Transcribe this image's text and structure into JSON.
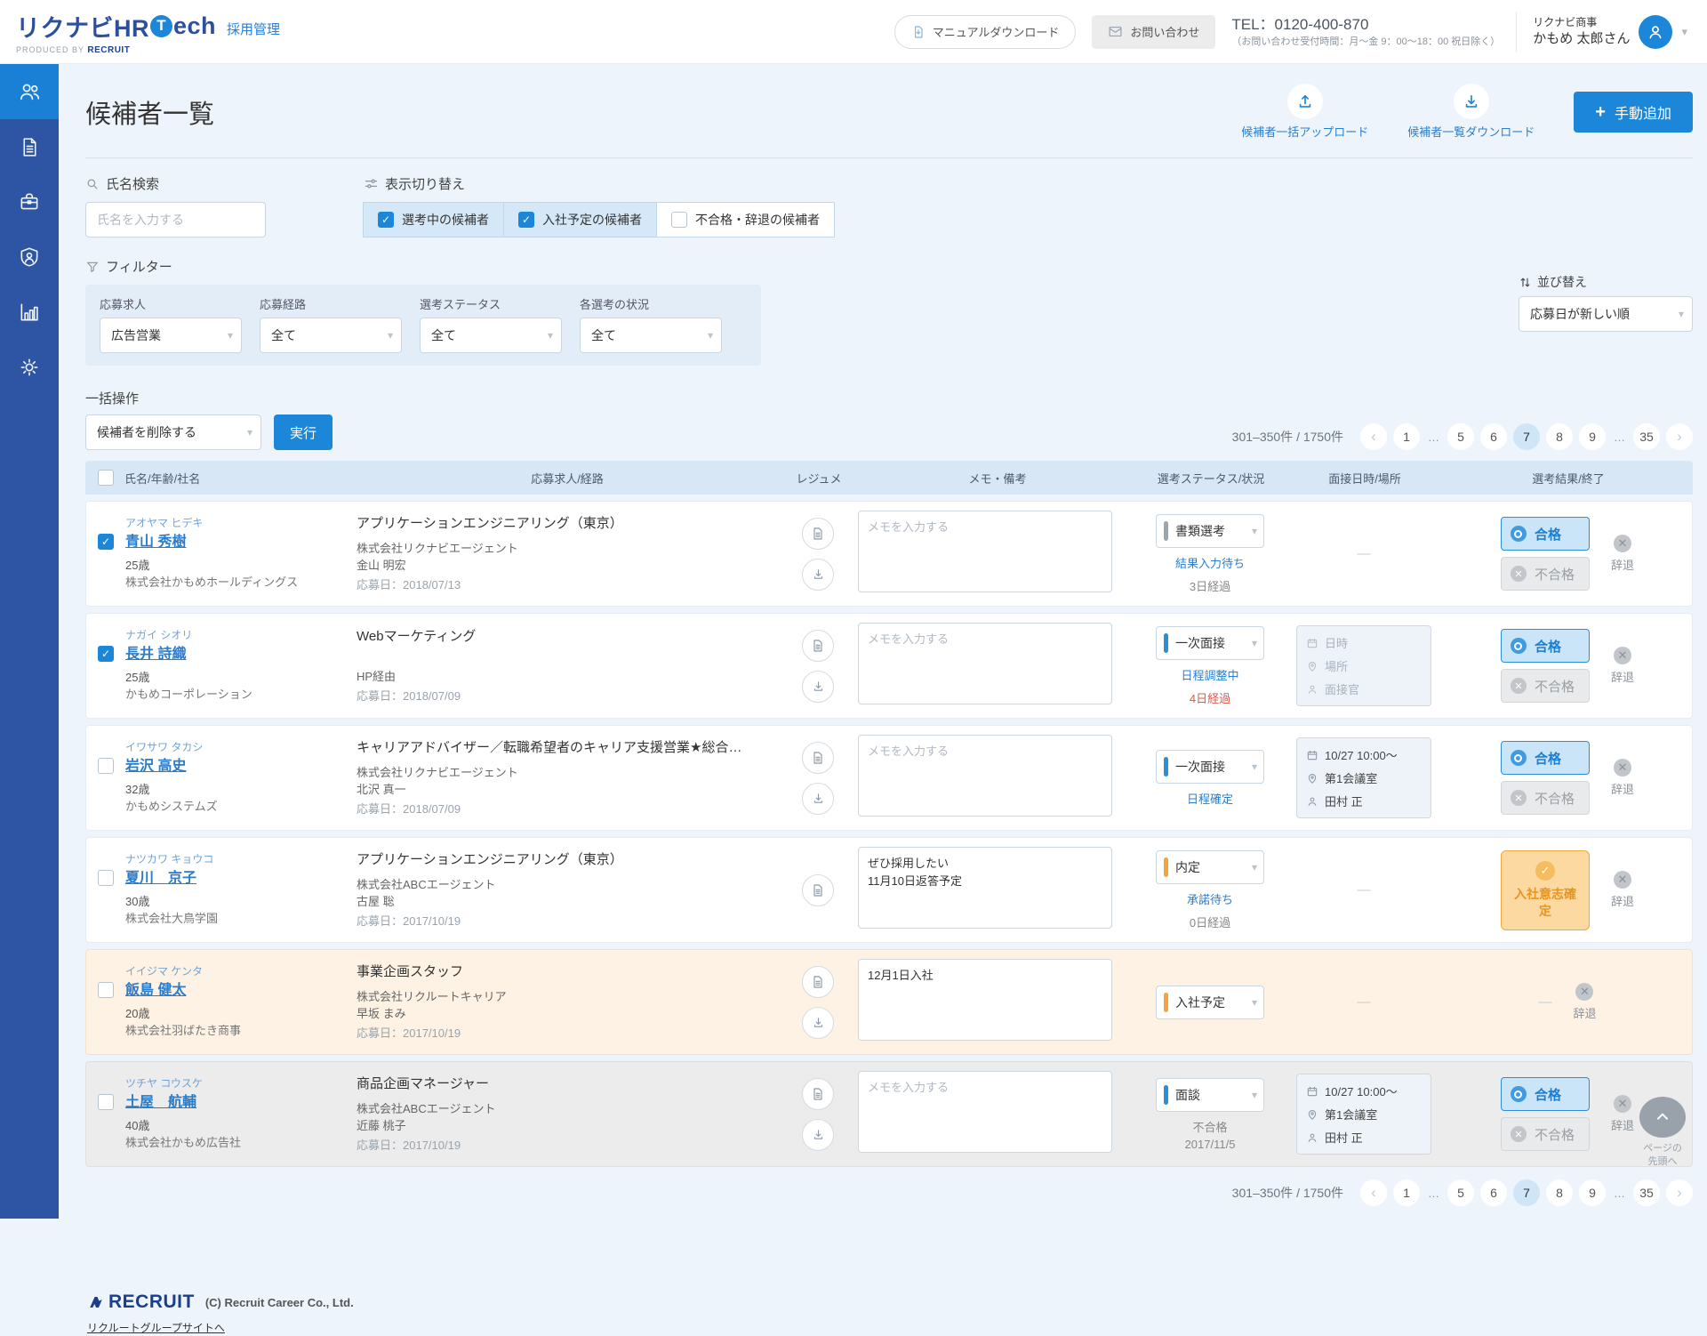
{
  "colors": {
    "accent_blue": "#1c87d8",
    "sidebar": "#2d55a3",
    "sidebar_active": "#1a80d6",
    "status_gray": "#9aa5b0",
    "status_blue": "#2a8fd8",
    "status_orange": "#f5a43c",
    "row_scheduled_bg": "#fdf2e3",
    "row_closed_bg": "#ececec",
    "alert_red": "#e05b4e"
  },
  "header": {
    "logo_main_left": "リクナビHR",
    "logo_t": "T",
    "logo_main_right": "ech",
    "logo_sub": "採用管理",
    "logo_produced": "PRODUCED BY ",
    "logo_recruit": "RECRUIT",
    "manual_download": "マニュアルダウンロード",
    "contact": "お問い合わせ",
    "tel": "TEL：0120-400-870",
    "tel_note": "（お問い合わせ受付時間：月〜金 9：00〜18：00 祝日除く）",
    "company": "リクナビ商事",
    "user": "かもめ 太郎さん"
  },
  "page": {
    "title": "候補者一覧",
    "upload_label": "候補者一括アップロード",
    "download_label": "候補者一覧ダウンロード",
    "add_label": "手動追加",
    "add_plus": "+"
  },
  "search": {
    "label": "氏名検索",
    "placeholder": "氏名を入力する"
  },
  "display_toggle": {
    "label": "表示切り替え",
    "options": [
      {
        "label": "選考中の候補者",
        "checked": true
      },
      {
        "label": "入社予定の候補者",
        "checked": true
      },
      {
        "label": "不合格・辞退の候補者",
        "checked": false
      }
    ]
  },
  "filters": {
    "label": "フィルター",
    "fields": [
      {
        "label": "応募求人",
        "value": "広告営業"
      },
      {
        "label": "応募経路",
        "value": "全て"
      },
      {
        "label": "選考ステータス",
        "value": "全て"
      },
      {
        "label": "各選考の状況",
        "value": "全て"
      }
    ],
    "sort": {
      "label": "並び替え",
      "value": "応募日が新しい順"
    }
  },
  "bulk": {
    "label": "一括操作",
    "action": "候補者を削除する",
    "execute": "実行"
  },
  "pagination": {
    "range": "301–350件 / 1750件",
    "prev": "‹",
    "next": "›",
    "pages": [
      "1",
      "…",
      "5",
      "6",
      "7",
      "8",
      "9",
      "…",
      "35"
    ],
    "active_page": "7"
  },
  "table": {
    "headers": [
      "氏名/年齢/社名",
      "応募求人/経路",
      "レジュメ",
      "メモ・備考",
      "選考ステータス/状況",
      "面接日時/場所",
      "選考結果/終了"
    ]
  },
  "rows": [
    {
      "checked": true,
      "kana": "アオヤマ ヒデキ",
      "name": "青山 秀樹",
      "age": "25歳",
      "company": "株式会社かもめホールディングス",
      "job_title": "アプリケーションエンジニアリング（東京）",
      "job_sub1": "株式会社リクナビエージェント",
      "job_sub2": "金山 明宏",
      "applied": "応募日：2018/07/13",
      "memo_placeholder": "メモを入力する",
      "status": "書類選考",
      "status_sub": "結果入力待ち",
      "status_note": "3日経過",
      "interview_dash": "—",
      "pass": "合格",
      "fail": "不合格",
      "decline": "辞退"
    },
    {
      "checked": true,
      "kana": "ナガイ シオリ",
      "name": "長井 詩織",
      "age": "25歳",
      "company": "かもめコーポレーション",
      "job_title": "Webマーケティング",
      "job_sub1": "HP経由",
      "applied": "応募日：2018/07/09",
      "memo_placeholder": "メモを入力する",
      "status": "一次面接",
      "status_sub": "日程調整中",
      "status_note": "4日経過",
      "interview_datetime": "日時",
      "interview_place": "場所",
      "interview_person": "面接官",
      "pass": "合格",
      "fail": "不合格",
      "decline": "辞退"
    },
    {
      "checked": false,
      "kana": "イワサワ タカシ",
      "name": "岩沢 高史",
      "age": "32歳",
      "company": "かもめシステムズ",
      "job_title": "キャリアアドバイザー／転職希望者のキャリア支援営業★総合…",
      "job_sub1": "株式会社リクナビエージェント",
      "job_sub2": "北沢 真一",
      "applied": "応募日：2018/07/09",
      "memo_placeholder": "メモを入力する",
      "status": "一次面接",
      "status_sub": "日程確定",
      "interview_datetime": "10/27  10:00〜",
      "interview_place": "第1会議室",
      "interview_person": "田村 正",
      "pass": "合格",
      "fail": "不合格",
      "decline": "辞退"
    },
    {
      "checked": false,
      "kana": "ナツカワ キョウコ",
      "name": "夏川　京子",
      "age": "30歳",
      "company": "株式会社大鳥学園",
      "job_title": "アプリケーションエンジニアリング（東京）",
      "job_sub1": "株式会社ABCエージェント",
      "job_sub2": "古屋 聡",
      "applied": "応募日：2017/10/19",
      "memo_value": "ぜひ採用したい\n11月10日返答予定",
      "status": "内定",
      "status_sub": "承諾待ち",
      "status_note": "0日経過",
      "interview_dash": "—",
      "confirm": "入社意志確定",
      "decline": "辞退"
    },
    {
      "checked": false,
      "kana": "イイジマ ケンタ",
      "name": "飯島 健太",
      "age": "20歳",
      "company": "株式会社羽ばたき商事",
      "job_title": "事業企画スタッフ",
      "job_sub1": "株式会社リクルートキャリア",
      "job_sub2": "早坂 まみ",
      "applied": "応募日：2017/10/19",
      "memo_value": "12月1日入社",
      "status": "入社予定",
      "interview_dash": "—",
      "result_dash": "—",
      "decline": "辞退"
    },
    {
      "checked": false,
      "kana": "ツチヤ コウスケ",
      "name": "土屋　航輔",
      "age": "40歳",
      "company": "株式会社かもめ広告社",
      "job_title": "商品企画マネージャー",
      "job_sub1": "株式会社ABCエージェント",
      "job_sub2": "近藤 桃子",
      "applied": "応募日：2017/10/19",
      "memo_placeholder": "メモを入力する",
      "status": "面談",
      "status_sub": "不合格",
      "status_note": "2017/11/5",
      "interview_datetime": "10/27  10:00〜",
      "interview_place": "第1会議室",
      "interview_person": "田村 正",
      "pass": "合格",
      "fail": "不合格",
      "decline": "辞退"
    }
  ],
  "footer": {
    "logo": "RECRUIT",
    "copyright": "(C) Recruit Career Co., Ltd.",
    "group_link": "リクルートグループサイトへ"
  },
  "back_to_top": "ページの先頭へ"
}
